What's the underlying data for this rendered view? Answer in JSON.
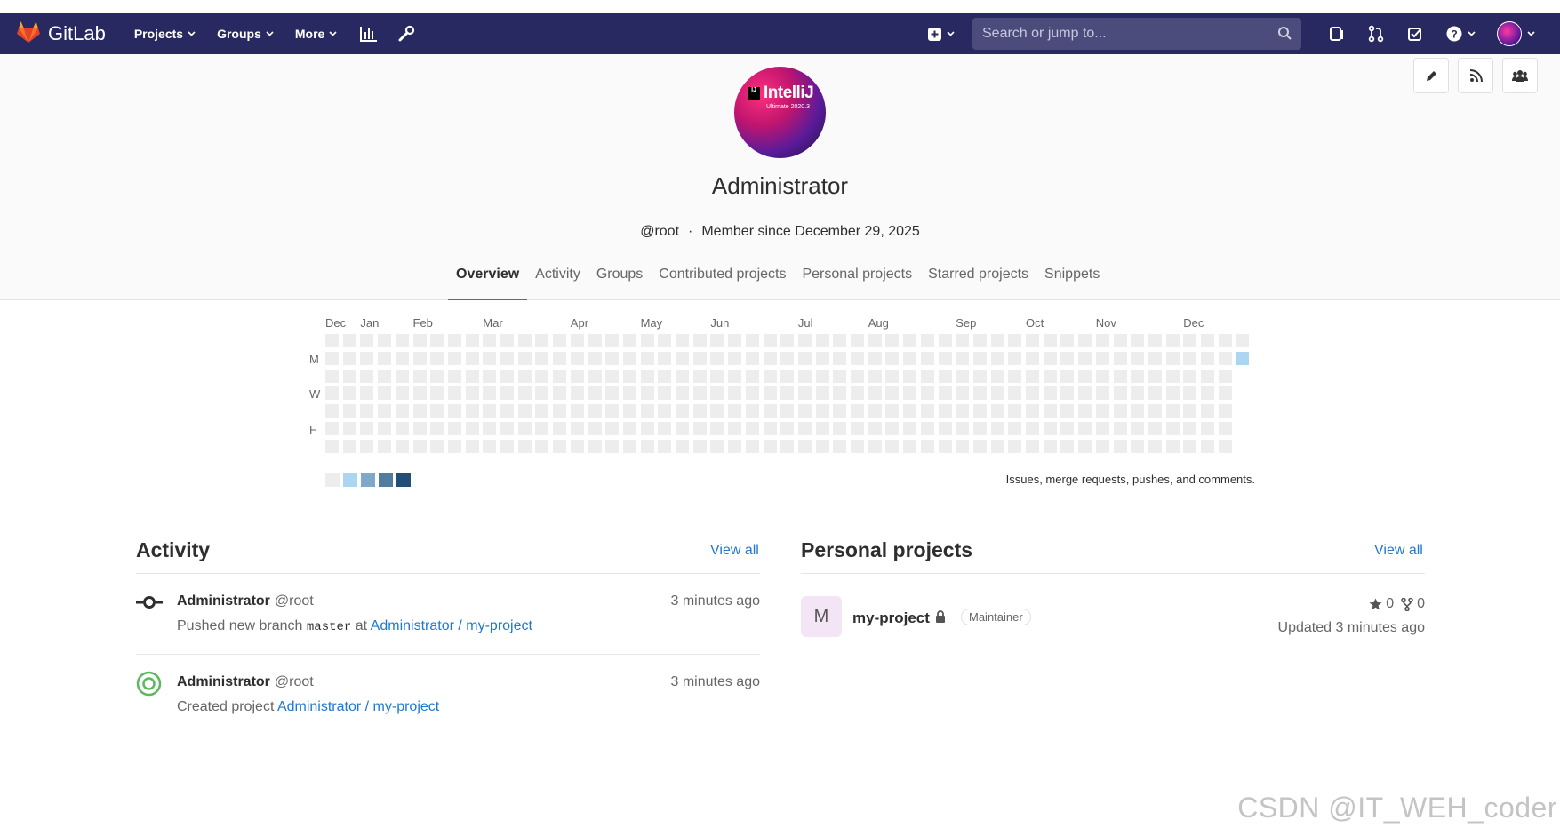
{
  "navbar": {
    "brand": "GitLab",
    "links": [
      "Projects",
      "Groups",
      "More"
    ],
    "search_placeholder": "Search or jump to..."
  },
  "profile": {
    "avatar_title": "IntelliJ",
    "avatar_subtitle": "Ultimate 2020.3",
    "avatar_badge": "IJ",
    "name": "Administrator",
    "handle": "@root",
    "separator": "·",
    "member_since": "Member since December 29, 2025"
  },
  "tabs": [
    "Overview",
    "Activity",
    "Groups",
    "Contributed projects",
    "Personal projects",
    "Starred projects",
    "Snippets"
  ],
  "active_tab": "Overview",
  "calendar": {
    "months": [
      "Dec",
      "Jan",
      "Feb",
      "Mar",
      "Apr",
      "May",
      "Jun",
      "Jul",
      "Aug",
      "Sep",
      "Oct",
      "Nov",
      "Dec"
    ],
    "day_labels": [
      "M",
      "W",
      "F"
    ],
    "weeks": 53,
    "active_cells": [
      {
        "week": 52,
        "day": 1,
        "level": 1
      }
    ],
    "legend_colors": [
      "#ededed",
      "#acd5f2",
      "#7fa8c9",
      "#527ba0",
      "#254e77"
    ],
    "caption": "Issues, merge requests, pushes, and comments."
  },
  "activity": {
    "title": "Activity",
    "view_all": "View all",
    "events": [
      {
        "author": "Administrator",
        "handle": "@root",
        "time": "3 minutes ago",
        "action": "Pushed new branch",
        "ref": "master",
        "at": "at",
        "project": "Administrator / my-project"
      },
      {
        "author": "Administrator",
        "handle": "@root",
        "time": "3 minutes ago",
        "action": "Created project",
        "project": "Administrator / my-project"
      }
    ]
  },
  "personal_projects": {
    "title": "Personal projects",
    "view_all": "View all",
    "projects": [
      {
        "initial": "M",
        "name": "my-project",
        "role": "Maintainer",
        "stars": "0",
        "forks": "0",
        "updated": "Updated 3 minutes ago"
      }
    ]
  },
  "watermark": "CSDN @IT_WEH_coder",
  "colors": {
    "navbar": "#292961",
    "link": "#1f78d1",
    "active_tab_underline": "#1f78d1",
    "push_icon": "#2e2e2e",
    "create_icon": "#5cb85c"
  }
}
